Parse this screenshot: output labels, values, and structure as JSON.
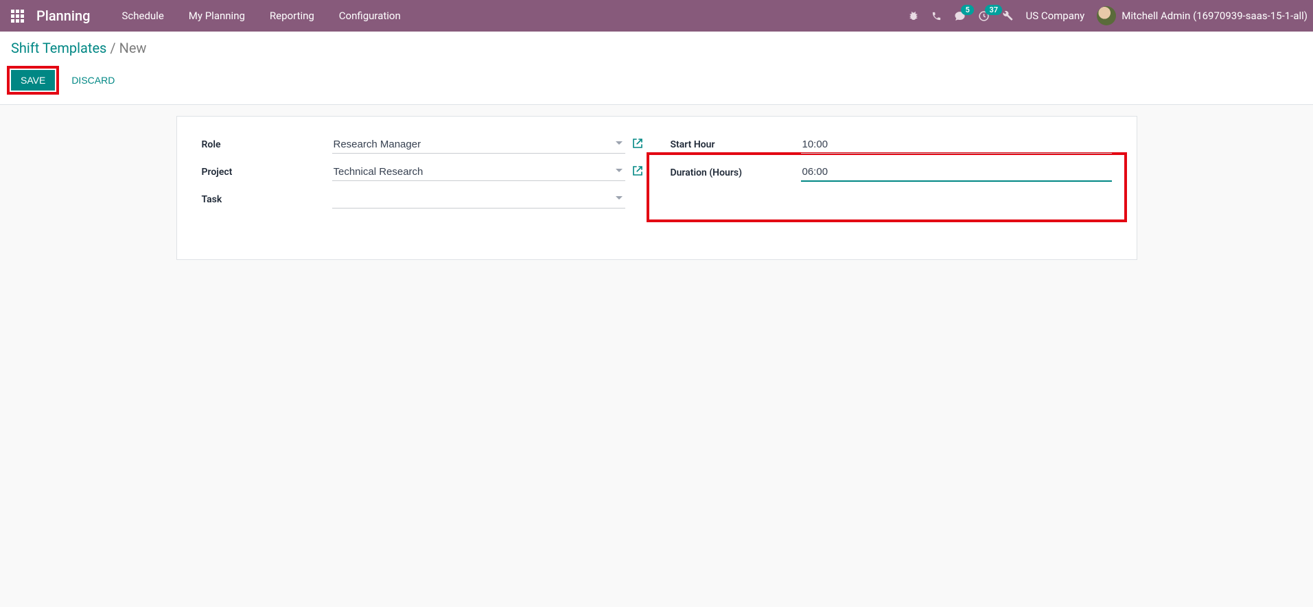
{
  "navbar": {
    "app_title": "Planning",
    "menu": [
      "Schedule",
      "My Planning",
      "Reporting",
      "Configuration"
    ],
    "badge_messages": "5",
    "badge_activities": "37",
    "company": "US Company",
    "username": "Mitchell Admin (16970939-saas-15-1-all)"
  },
  "breadcrumb": {
    "root": "Shift Templates",
    "sep": " / ",
    "current": "New"
  },
  "buttons": {
    "save": "Save",
    "discard": "Discard"
  },
  "form": {
    "left": {
      "role_label": "Role",
      "role_value": "Research Manager",
      "project_label": "Project",
      "project_value": "Technical Research",
      "task_label": "Task",
      "task_value": ""
    },
    "right": {
      "start_label": "Start Hour",
      "start_value": "10:00",
      "duration_label": "Duration (Hours)",
      "duration_value": "06:00"
    }
  }
}
